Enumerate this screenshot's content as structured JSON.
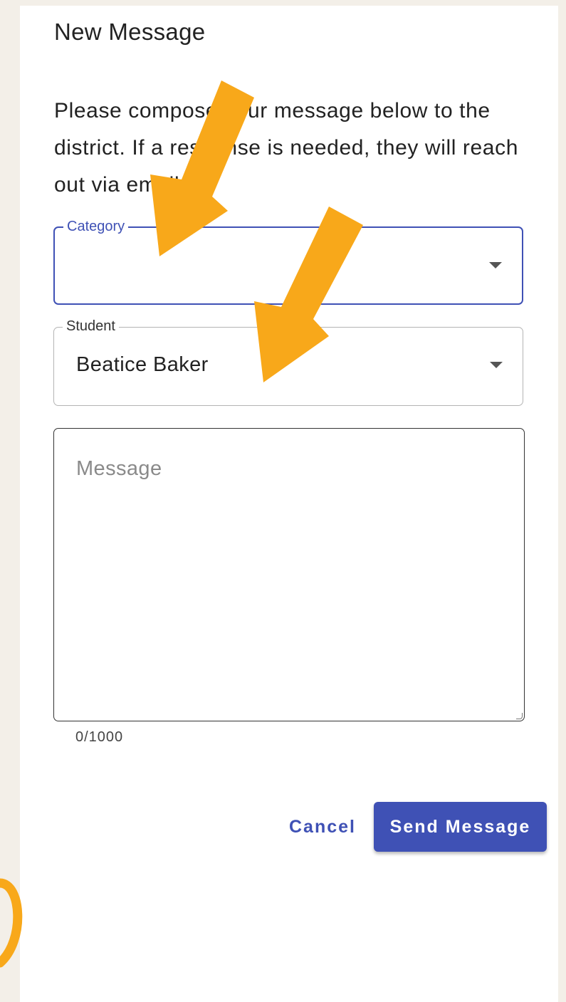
{
  "dialog": {
    "title": "New Message",
    "intro": "Please compose your message below to the district. If a response is needed, they will reach out via email."
  },
  "category_field": {
    "label": "Category",
    "value": ""
  },
  "student_field": {
    "label": "Student",
    "value": "Beatice Baker"
  },
  "message_field": {
    "placeholder": "Message",
    "counter": "0/1000"
  },
  "actions": {
    "cancel_label": "Cancel",
    "send_label": "Send Message"
  },
  "colors": {
    "background": "#f3efe8",
    "panel": "#ffffff",
    "accent": "#3f51b5",
    "annotation_arrow": "#f8a81a"
  },
  "icons": {
    "dropdown": "arrow-drop-down-icon",
    "annotation": "arrow-annotation"
  }
}
